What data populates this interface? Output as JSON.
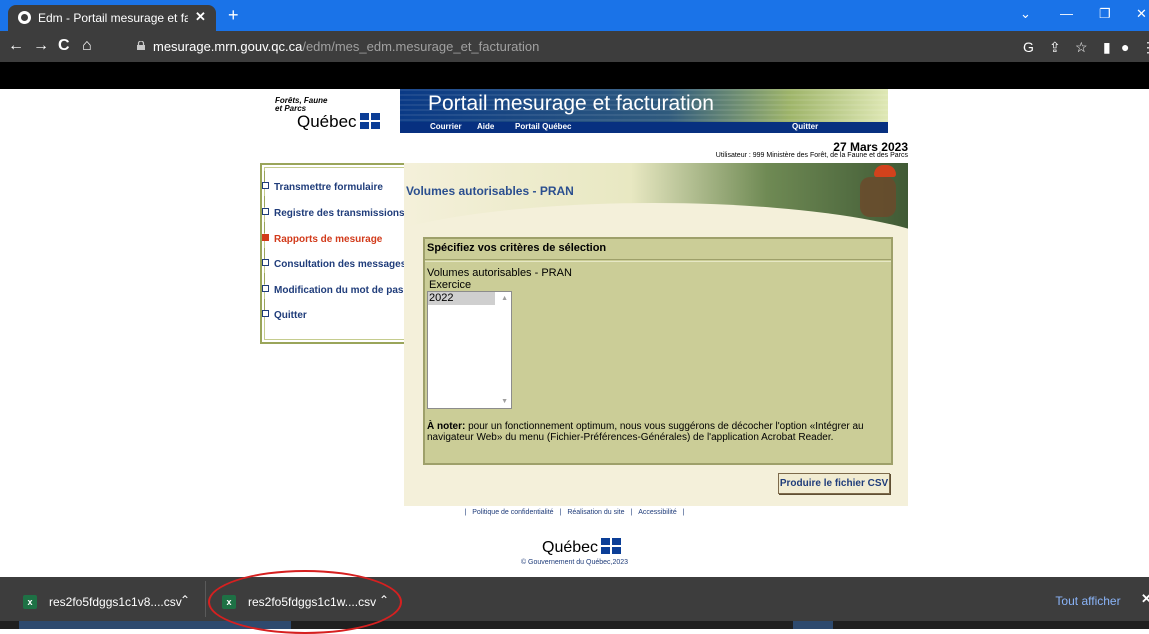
{
  "browser": {
    "tab_title": "Edm - Portail mesurage et facturation",
    "tab_close": "✕",
    "new_tab": "+",
    "url_host": "mesurage.mrn.gouv.qc.ca",
    "url_path": "/edm/mes_edm.mesurage_et_facturation"
  },
  "site": {
    "ministry_line1": "Forêts, Faune",
    "ministry_line2": "et Parcs",
    "quebec_logo": "Québec",
    "banner_title": "Portail mesurage et facturation",
    "links": [
      "Courrier",
      "Aide",
      "Portail Québec",
      "Quitter"
    ],
    "date": "27 Mars 2023",
    "user": "Utilisateur : 999 Ministère des Forêt, de la Faune et des Parcs"
  },
  "sidebar": {
    "items": [
      {
        "label": "Transmettre formulaire",
        "active": false
      },
      {
        "label": "Registre des transmissions",
        "active": false
      },
      {
        "label": "Rapports de mesurage",
        "active": true
      },
      {
        "label": "Consultation des messages",
        "active": false
      },
      {
        "label": "Modification du mot de passe",
        "active": false
      },
      {
        "label": "Quitter",
        "active": false
      }
    ]
  },
  "main": {
    "title": "Volumes autorisables - PRAN",
    "criteria_title": "Spécifiez vos critères de sélection",
    "report_name": "Volumes autorisables - PRAN",
    "exercise_label": "Exercice",
    "exercise_options": [
      "2022"
    ],
    "note_bold": "À noter:",
    "note_text": " pour un fonctionnement optimum, nous vous suggérons de décocher l'option «Intégrer au navigateur Web» du menu (Fichier-Préférences-Générales) de l'application Acrobat Reader.",
    "csv_button": "Produire le fichier CSV"
  },
  "footer": {
    "links": [
      "Politique de confidentialité",
      "Réalisation du site",
      "Accessibilité"
    ],
    "separator": "|",
    "logo": "Québec",
    "copyright": "© Gouvernement du Québec,2023"
  },
  "downloads": {
    "items": [
      "res2fo5fdggs1c1v8....csv",
      "res2fo5fdggs1c1w....csv"
    ],
    "show_all": "Tout afficher",
    "close": "✕"
  },
  "colors": {
    "tabbar": "#1a73e8",
    "chrome": "#3d3d3d",
    "nav_link": "#1f3c7a",
    "active_menu": "#d23a1a",
    "panel": "#cbcd97",
    "annotation": "#d62020"
  }
}
